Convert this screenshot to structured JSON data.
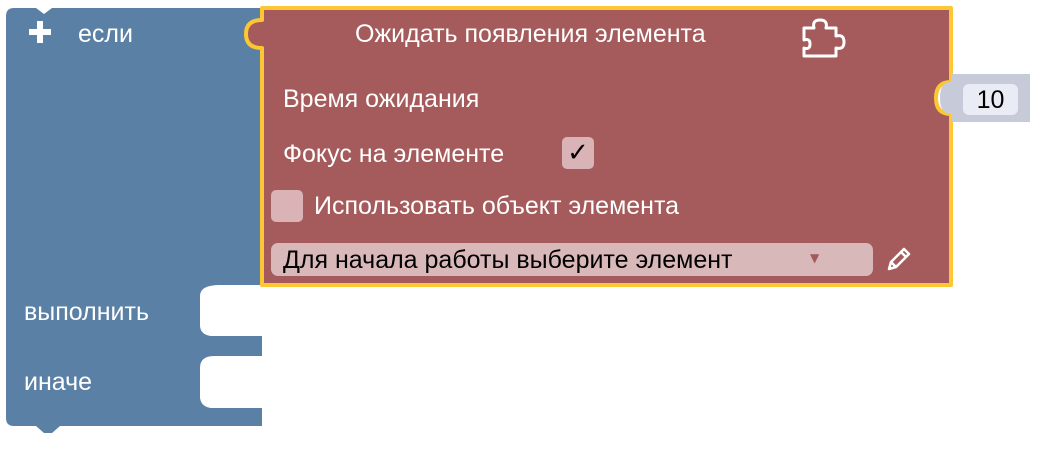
{
  "if_block": {
    "color": "#5b80a5",
    "if_label": "если",
    "do_label": "выполнить",
    "else_label": "иначе",
    "mutator_icon": "plus-icon"
  },
  "wait_block": {
    "color": "#a55b5b",
    "highlight_color": "#fcc733",
    "title": "Ожидать появления элемента",
    "title_icon": "puzzle-icon",
    "wait_time_label": "Время ожидания",
    "focus_label": "Фокус на элементе",
    "focus_checked": true,
    "focus_check_glyph": "✓",
    "use_object_label": "Использовать объект элемента",
    "use_object_checked": false,
    "element_dropdown": {
      "selected": "Для начала работы выберите элемент",
      "arrow": "▼"
    },
    "edit_icon": "pencil-icon"
  },
  "number_block": {
    "color": "#c6cad9",
    "value": "10"
  }
}
